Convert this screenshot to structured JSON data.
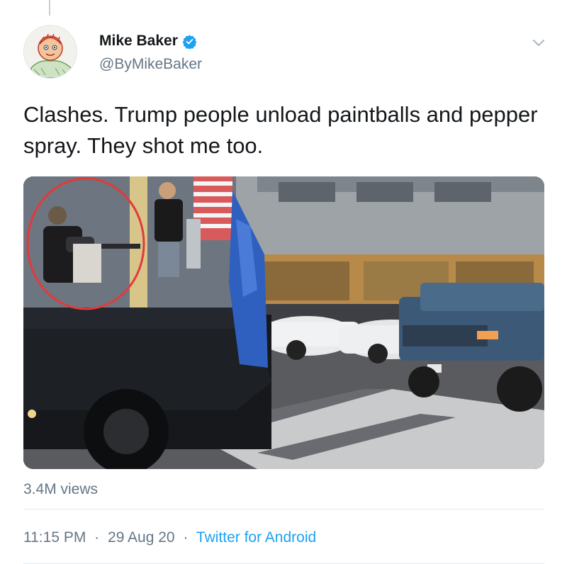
{
  "tweet": {
    "author": {
      "name": "Mike Baker",
      "handle": "@ByMikeBaker",
      "verified": true
    },
    "text": "Clashes. Trump people unload paintballs and pepper spray. They shot me too.",
    "media": {
      "type": "video"
    },
    "views": "3.4M views",
    "time": "11:15 PM",
    "date": "29 Aug 20",
    "separator": "·",
    "source": "Twitter for Android"
  },
  "colors": {
    "accent": "#1da1f2",
    "secondary_text": "#657786",
    "primary_text": "#14171a",
    "divider": "#e1e8ed"
  },
  "icons": {
    "verified": "verified-badge-icon",
    "more": "chevron-down-icon"
  }
}
